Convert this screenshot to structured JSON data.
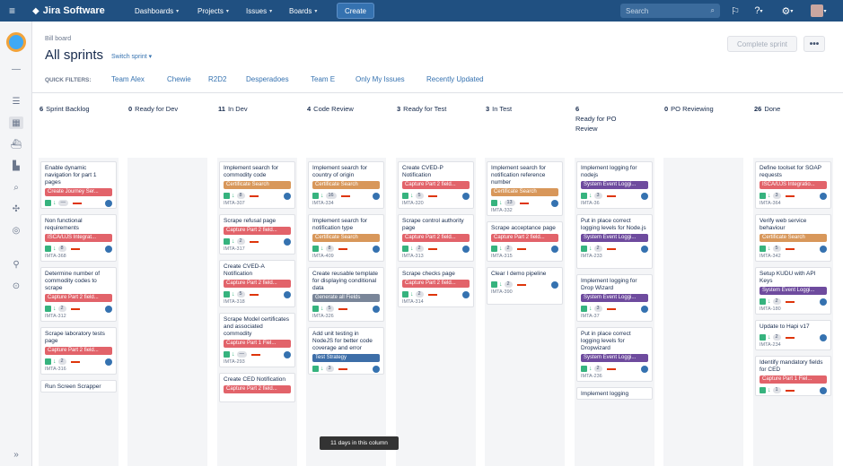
{
  "topbar": {
    "menu": "≡",
    "logo": "Jira Software",
    "nav": [
      "Dashboards",
      "Projects",
      "Issues",
      "Boards"
    ],
    "create": "Create",
    "search_placeholder": "Search"
  },
  "board": {
    "breadcrumb": "Bill board",
    "title": "All sprints",
    "switch_sprint": "Switch sprint",
    "complete_sprint": "Complete sprint",
    "more": "•••"
  },
  "quick_filters": {
    "label": "QUICK FILTERS:",
    "items": [
      "Team Alex",
      "Chewie",
      "R2D2",
      "Desperadoes",
      "Team E",
      "Only My Issues",
      "Recently Updated"
    ]
  },
  "columns": [
    {
      "count": "6",
      "name": "Sprint Backlog"
    },
    {
      "count": "0",
      "name": "Ready for Dev"
    },
    {
      "count": "11",
      "name": "In Dev"
    },
    {
      "count": "4",
      "name": "Code Review"
    },
    {
      "count": "3",
      "name": "Ready for Test"
    },
    {
      "count": "3",
      "name": "In Test"
    },
    {
      "count": "6",
      "name": "Ready for PO Review"
    },
    {
      "count": "0",
      "name": "PO Reviewing"
    },
    {
      "count": "26",
      "name": "Done"
    }
  ],
  "epics": {
    "red": "#e2636a",
    "orange": "#d8975a",
    "purple": "#6e4b9e",
    "gray": "#7a8699",
    "blue": "#3d6ea8"
  },
  "cards": {
    "c0": [
      {
        "title": "Enable dynamic navigation for part 1 pages",
        "epic": "Create Journey Ser...",
        "color": "red",
        "pill": "—",
        "key": "IMTA-403"
      },
      {
        "title": "Non functional requirements",
        "epic": "ISCA/UJS Integrat...",
        "color": "red",
        "pill": "8",
        "key": "IMTA-368"
      },
      {
        "title": "Determine number of commodity codes to scrape",
        "epic": "Capture Part 2 field...",
        "color": "red",
        "pill": "2",
        "key": "IMTA-312"
      },
      {
        "title": "Scrape laboratory tests page",
        "epic": "Capture Part 2 field...",
        "color": "red",
        "pill": "2",
        "key": "IMTA-316"
      },
      {
        "title": "Run Screen Scrapper",
        "epic": "",
        "color": "red",
        "pill": "",
        "key": ""
      }
    ],
    "c2": [
      {
        "title": "Implement search for commodity code",
        "epic": "Certificate Search",
        "color": "orange",
        "pill": "8",
        "key": "IMTA-307"
      },
      {
        "title": "Scrape refusal page",
        "epic": "Capture Part 2 field...",
        "color": "red",
        "pill": "2",
        "key": "IMTA-317"
      },
      {
        "title": "Create CVED-A Notification",
        "epic": "Capture Part 2 field...",
        "color": "red",
        "pill": "5",
        "key": "IMTA-318"
      },
      {
        "title": "Scrape Model certificates and associated commodity",
        "epic": "Capture Part 1 Fiel...",
        "color": "red",
        "pill": "—",
        "key": "IMTA-293"
      },
      {
        "title": "Create CED Notification",
        "epic": "Capture Part 2 field...",
        "color": "red",
        "pill": "",
        "key": ""
      }
    ],
    "c3": [
      {
        "title": "Implement search for country of origin",
        "epic": "Certificate Search",
        "color": "orange",
        "pill": "16",
        "key": "IMTA-334"
      },
      {
        "title": "Implement search for notification type",
        "epic": "Certificate Search",
        "color": "orange",
        "pill": "8",
        "key": "IMTA-409"
      },
      {
        "title": "Create reusable template for displaying conditional data",
        "epic": "Generate all Fields",
        "color": "gray",
        "pill": "5",
        "key": "IMTA-326"
      },
      {
        "title": "Add unit testing in NodeJS for better code coverage and error",
        "epic": "Test Strategy",
        "color": "blue",
        "pill": "3",
        "key": ""
      }
    ],
    "c4": [
      {
        "title": "Create CVED-P Notification",
        "epic": "Capture Part 2 field...",
        "color": "red",
        "pill": "5",
        "key": "IMTA-320"
      },
      {
        "title": "Scrape control authority page",
        "epic": "Capture Part 2 field...",
        "color": "red",
        "pill": "2",
        "key": "IMTA-313"
      },
      {
        "title": "Scrape checks page",
        "epic": "Capture Part 2 field...",
        "color": "red",
        "pill": "2",
        "key": "IMTA-314"
      }
    ],
    "c5": [
      {
        "title": "Implement search for notification reference number",
        "epic": "Certificate Search",
        "color": "orange",
        "pill": "13",
        "key": "IMTA-332"
      },
      {
        "title": "Scrape acceptance page",
        "epic": "Capture Part 2 field...",
        "color": "red",
        "pill": "2",
        "key": "IMTA-315"
      },
      {
        "title": "Clear         I demo pipeline",
        "epic": "",
        "color": "red",
        "pill": "2",
        "key": "IMTA-390"
      }
    ],
    "c6": [
      {
        "title": "Implement logging for nodejs",
        "epic": "System Event Loggi...",
        "color": "purple",
        "pill": "3",
        "key": "IMTA-36"
      },
      {
        "title": "Put in place correct logging levels for Node.js",
        "epic": "System Event Loggi...",
        "color": "purple",
        "pill": "2",
        "key": "IMTA-233"
      },
      {
        "title": "Implement logging for Drop Wizard",
        "epic": "System Event Loggi...",
        "color": "purple",
        "pill": "3",
        "key": "IMTA-37"
      },
      {
        "title": "Put in place correct logging levels for Dropwizard",
        "epic": "System Event Loggi...",
        "color": "purple",
        "pill": "2",
        "key": "IMTA-236"
      },
      {
        "title": "Implement logging",
        "epic": "",
        "color": "purple",
        "pill": "",
        "key": ""
      }
    ],
    "c8": [
      {
        "title": "Define toolset for SOAP requests",
        "epic": "ISCA/UJS Integratio...",
        "color": "red",
        "pill": "3",
        "key": "IMTA-364"
      },
      {
        "title": "Verify          web service behaviour",
        "epic": "Certificate Search",
        "color": "orange",
        "pill": "5",
        "key": "IMTA-342"
      },
      {
        "title": "Setup KUDU with API Keys",
        "epic": "System Event Loggi...",
        "color": "purple",
        "pill": "2",
        "key": "IMTA-180"
      },
      {
        "title": "Update to Hapi v17",
        "epic": "",
        "color": "red",
        "pill": "2",
        "key": "IMTA-234"
      },
      {
        "title": "Identify mandatory fields for CED",
        "epic": "Capture Part 1 Fiel...",
        "color": "red",
        "pill": "1",
        "key": ""
      }
    ]
  },
  "tooltip": "11 days in this column"
}
